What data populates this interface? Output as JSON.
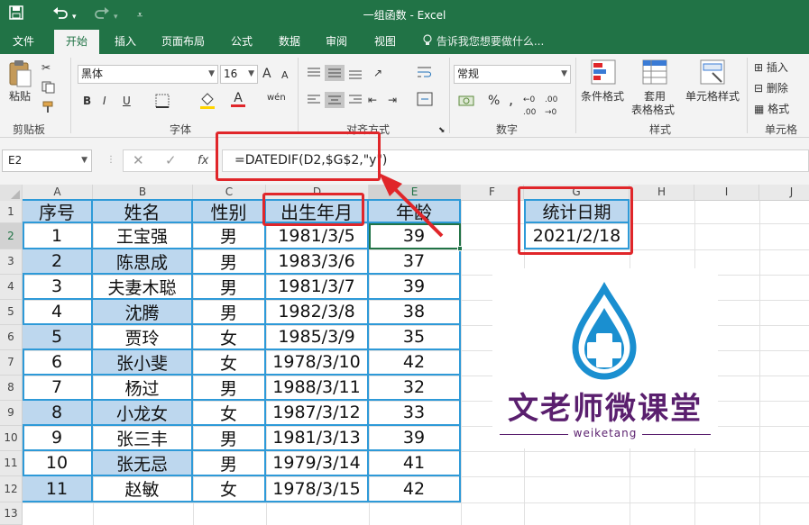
{
  "window": {
    "title": "一组函数 - Excel"
  },
  "quick_access": {
    "save_icon": "save-icon",
    "undo_icon": "undo-icon",
    "redo_icon": "redo-icon",
    "customize_icon": "customize-icon"
  },
  "tabs": [
    {
      "label": "文件",
      "active": false
    },
    {
      "label": "开始",
      "active": true
    },
    {
      "label": "插入",
      "active": false
    },
    {
      "label": "页面布局",
      "active": false
    },
    {
      "label": "公式",
      "active": false
    },
    {
      "label": "数据",
      "active": false
    },
    {
      "label": "审阅",
      "active": false
    },
    {
      "label": "视图",
      "active": false
    }
  ],
  "tell_me": "告诉我您想要做什么...",
  "ribbon": {
    "clipboard": {
      "paste": "粘贴",
      "label": "剪贴板"
    },
    "font": {
      "name": "黑体",
      "size": "16",
      "label": "字体",
      "bold": "B",
      "italic": "I",
      "underline": "U",
      "grow": "A",
      "shrink": "A",
      "phonetic": "wén",
      "font_color": "A"
    },
    "alignment": {
      "label": "对齐方式"
    },
    "number": {
      "format": "常规",
      "label": "数字",
      "percent": "%",
      "comma": ","
    },
    "styles": {
      "conditional": "条件格式",
      "table_line1": "套用",
      "table_line2": "表格格式",
      "cell_styles": "单元格样式",
      "label": "样式"
    },
    "cells": {
      "insert": "插入",
      "delete": "删除",
      "format": "格式",
      "label": "单元格"
    }
  },
  "formula_bar": {
    "name_box": "E2",
    "cancel": "✕",
    "enter": "✓",
    "fx": "fx",
    "formula": "=DATEDIF(D2,$G$2,\"y\")"
  },
  "columns": [
    "A",
    "B",
    "C",
    "D",
    "E",
    "F",
    "G",
    "H",
    "I",
    "J"
  ],
  "rows": [
    "1",
    "2",
    "3",
    "4",
    "5",
    "6",
    "7",
    "8",
    "9",
    "10",
    "11",
    "12",
    "13"
  ],
  "table": {
    "headers": [
      "序号",
      "姓名",
      "性别",
      "出生年月",
      "年龄"
    ],
    "rows": [
      [
        "1",
        "王宝强",
        "男",
        "1981/3/5",
        "39"
      ],
      [
        "2",
        "陈思成",
        "男",
        "1983/3/6",
        "37"
      ],
      [
        "3",
        "夫妻木聪",
        "男",
        "1981/3/7",
        "39"
      ],
      [
        "4",
        "沈腾",
        "男",
        "1982/3/8",
        "38"
      ],
      [
        "5",
        "贾玲",
        "女",
        "1985/3/9",
        "35"
      ],
      [
        "6",
        "张小斐",
        "女",
        "1978/3/10",
        "42"
      ],
      [
        "7",
        "杨过",
        "男",
        "1988/3/11",
        "32"
      ],
      [
        "8",
        "小龙女",
        "女",
        "1987/3/12",
        "33"
      ],
      [
        "9",
        "张三丰",
        "男",
        "1981/3/13",
        "39"
      ],
      [
        "10",
        "张无忌",
        "男",
        "1979/3/14",
        "41"
      ],
      [
        "11",
        "赵敏",
        "女",
        "1978/3/15",
        "42"
      ]
    ]
  },
  "stat": {
    "header": "统计日期",
    "value": "2021/2/18"
  },
  "logo": {
    "title": "文老师微课堂",
    "subtitle": "weiketang"
  },
  "colors": {
    "excel_green": "#217346",
    "header_fill": "#bdd7ee",
    "border_blue": "#2e9ad8",
    "annotation_red": "#e0262a",
    "logo_purple": "#5a1f6e",
    "drop_blue": "#1a8fd0"
  }
}
